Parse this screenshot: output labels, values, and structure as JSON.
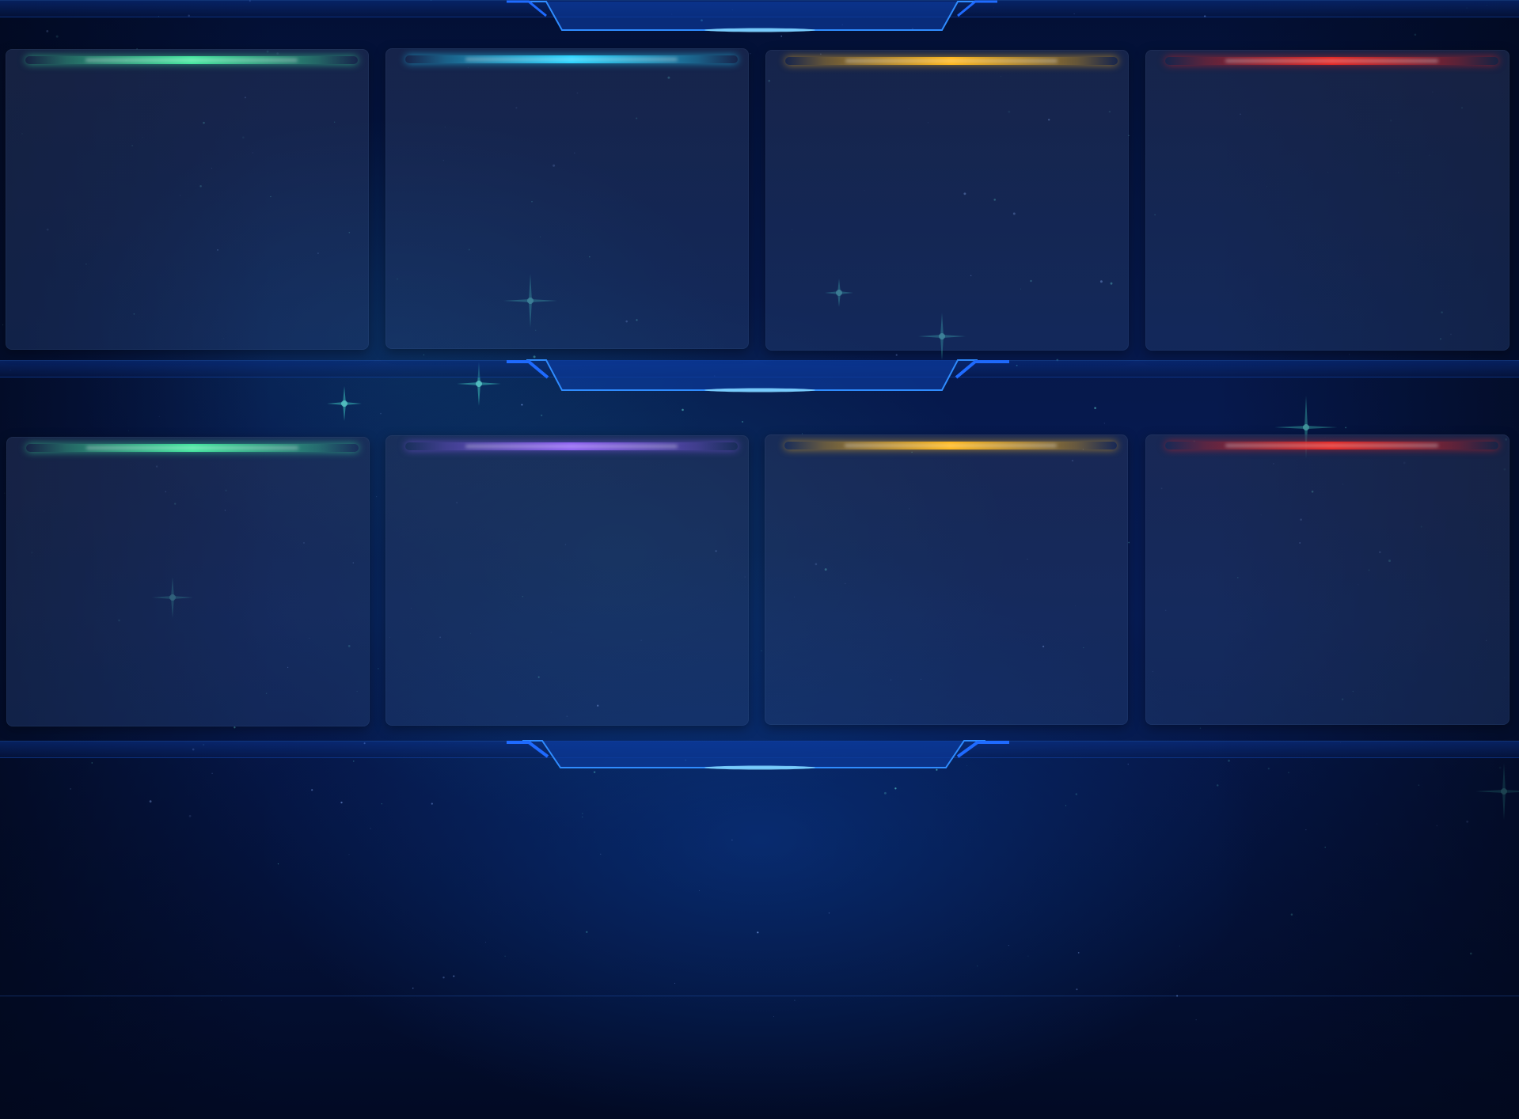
{
  "dashboard": {
    "rows": [
      {
        "cards": [
          {
            "accent": "#3ee59b",
            "title": "",
            "body": ""
          },
          {
            "accent": "#22d3ff",
            "title": "",
            "body": ""
          },
          {
            "accent": "#ffb515",
            "title": "",
            "body": ""
          },
          {
            "accent": "#e0211f",
            "title": "",
            "body": ""
          }
        ]
      },
      {
        "cards": [
          {
            "accent": "#3ee59b",
            "title": "",
            "body": ""
          },
          {
            "accent": "#8a5cf2",
            "title": "",
            "body": ""
          },
          {
            "accent": "#ffb515",
            "title": "",
            "body": ""
          },
          {
            "accent": "#e0211f",
            "title": "",
            "body": ""
          }
        ]
      }
    ],
    "theme": {
      "background": "#031035",
      "divider": "#1a5fd6",
      "divider_highlight": "#4cb3ff"
    }
  }
}
